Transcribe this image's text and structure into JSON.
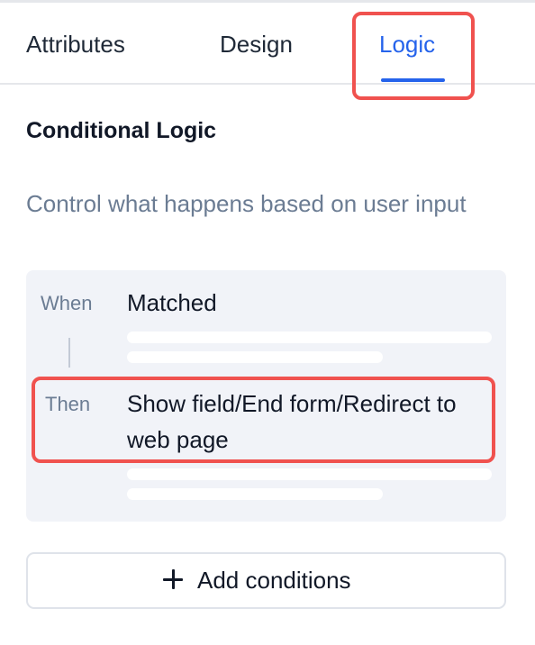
{
  "tabs": [
    {
      "label": "Attributes",
      "active": false
    },
    {
      "label": "Design",
      "active": false
    },
    {
      "label": "Logic",
      "active": true
    }
  ],
  "section": {
    "title": "Conditional Logic",
    "description": "Control what happens based on user input"
  },
  "logic": {
    "when": {
      "label": "When",
      "value": "Matched"
    },
    "then": {
      "label": "Then",
      "value": "Show field/End form/Redirect to web page"
    }
  },
  "add_button": {
    "label": "Add conditions",
    "icon": "plus-icon"
  },
  "colors": {
    "accent": "#2563eb",
    "highlight": "#f0524f",
    "muted_text": "#6b7c93",
    "panel_background": "#f1f3f8"
  }
}
